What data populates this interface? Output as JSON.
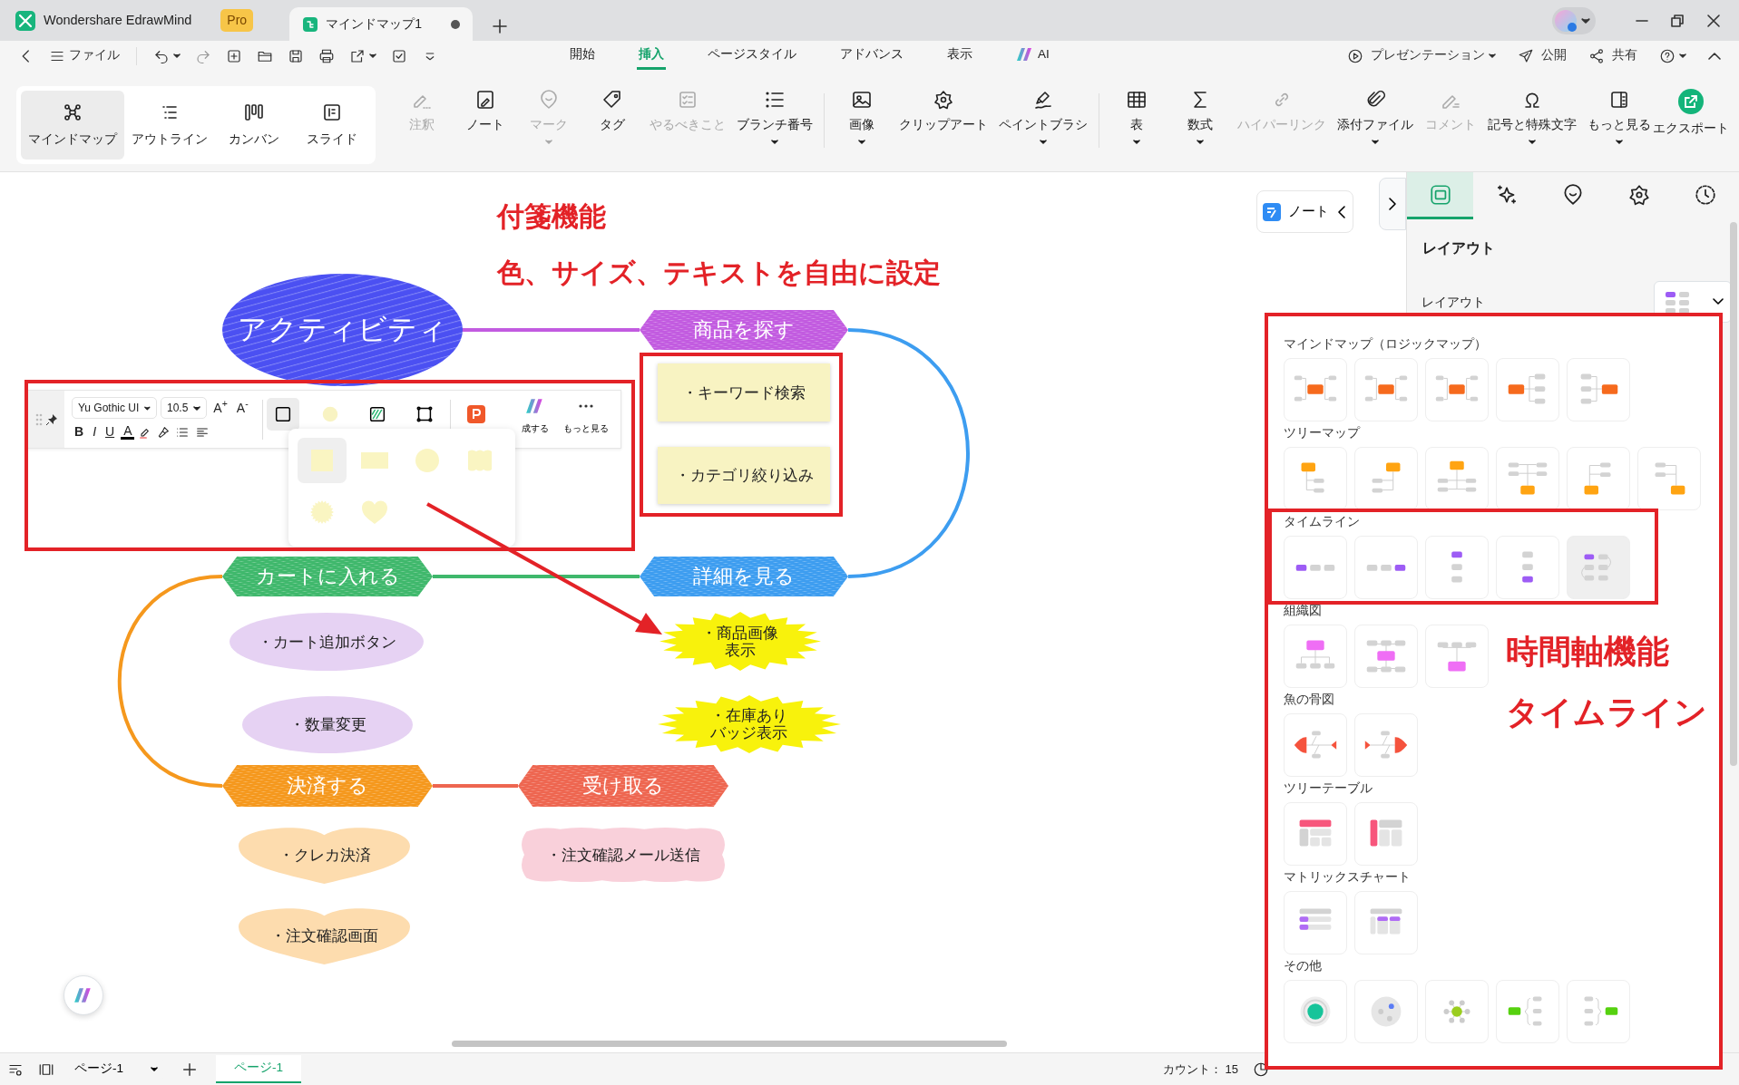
{
  "title_bar": {
    "app_name": "Wondershare EdrawMind",
    "badge": "Pro",
    "tabs": [
      {
        "label": "マインドマップ1",
        "selected": true,
        "unsaved": true
      }
    ]
  },
  "menu_bar": {
    "file_label": "ファイル",
    "tabs": [
      {
        "label": "開始",
        "selected": false
      },
      {
        "label": "挿入",
        "selected": true
      },
      {
        "label": "ページスタイル",
        "selected": false
      },
      {
        "label": "アドバンス",
        "selected": false
      },
      {
        "label": "表示",
        "selected": false
      },
      {
        "label": "AI",
        "selected": false
      }
    ],
    "actions": [
      {
        "label": "プレゼンテーション",
        "dropdown": true
      },
      {
        "label": "公開",
        "dropdown": false
      },
      {
        "label": "共有",
        "dropdown": false
      }
    ]
  },
  "ribbon": {
    "views": [
      {
        "label": "マインドマップ",
        "selected": true
      },
      {
        "label": "アウトライン",
        "selected": false
      },
      {
        "label": "カンバン",
        "selected": false
      },
      {
        "label": "スライド",
        "selected": false
      }
    ],
    "groups": [
      {
        "tools": [
          {
            "label": "注釈",
            "disabled": true,
            "dropdown": false
          },
          {
            "label": "ノート",
            "disabled": false,
            "dropdown": false
          },
          {
            "label": "マーク",
            "disabled": true,
            "dropdown": true
          },
          {
            "label": "タグ",
            "disabled": false,
            "dropdown": false
          },
          {
            "label": "やるべきこと",
            "disabled": true,
            "dropdown": false
          },
          {
            "label": "ブランチ番号",
            "disabled": false,
            "dropdown": true
          }
        ]
      },
      {
        "tools": [
          {
            "label": "画像",
            "disabled": false,
            "dropdown": true
          },
          {
            "label": "クリップアート",
            "disabled": false,
            "dropdown": false
          },
          {
            "label": "ペイントブラシ",
            "disabled": false,
            "dropdown": true
          }
        ]
      },
      {
        "tools": [
          {
            "label": "表",
            "disabled": false,
            "dropdown": true
          },
          {
            "label": "数式",
            "disabled": false,
            "dropdown": true
          },
          {
            "label": "ハイパーリンク",
            "disabled": true,
            "dropdown": false
          },
          {
            "label": "添付ファイル",
            "disabled": false,
            "dropdown": true
          },
          {
            "label": "コメント",
            "disabled": true,
            "dropdown": false
          },
          {
            "label": "記号と特殊文字",
            "disabled": false,
            "dropdown": true
          },
          {
            "label": "もっと見る",
            "disabled": false,
            "dropdown": true
          }
        ]
      }
    ],
    "export_label": "エクスポート"
  },
  "canvas": {
    "annotations": [
      {
        "text": "付箋機能"
      },
      {
        "text": "色、サイズ、テキストを自由に設定"
      }
    ],
    "nodes": [
      {
        "text": "アクティビティ",
        "kind": "central",
        "color": "#4b50f2"
      },
      {
        "text": "商品を探す",
        "kind": "main",
        "color": "#c25be0"
      },
      {
        "text": "・キーワード検索",
        "kind": "sticky",
        "color": "#f8f3c2"
      },
      {
        "text": "・カテゴリ絞り込み",
        "kind": "sticky",
        "color": "#f8f3c2"
      },
      {
        "text": "カートに入れる",
        "kind": "main",
        "color": "#3fb86c"
      },
      {
        "text": "詳細を見る",
        "kind": "main",
        "color": "#3d9df0"
      },
      {
        "text": "・カート追加ボタン",
        "kind": "ellipse",
        "color": "#e6d2f3"
      },
      {
        "text": "・商品画像表示",
        "kind": "burst",
        "color": "#f8f20c"
      },
      {
        "text": "・数量変更",
        "kind": "ellipse",
        "color": "#e6d2f3"
      },
      {
        "text": "・在庫ありバッジ表示",
        "kind": "burst",
        "color": "#f8f20c"
      },
      {
        "text": "決済する",
        "kind": "main",
        "color": "#f5981d"
      },
      {
        "text": "受け取る",
        "kind": "main",
        "color": "#ee6650"
      },
      {
        "text": "・クレカ決済",
        "kind": "heart",
        "color": "#fddcae"
      },
      {
        "text": "・注文確認メール送信",
        "kind": "cloud",
        "color": "#f9d0da"
      },
      {
        "text": "・注文確認画面",
        "kind": "heart",
        "color": "#fddcae"
      }
    ],
    "note_button": "ノート",
    "format_bar": {
      "font": "Yu Gothic UI",
      "font_size": "10.5",
      "size_keys": [
        "A$^{+}$",
        "A$^{-}$"
      ],
      "format_keys": [
        "B",
        "I",
        "U",
        "A"
      ],
      "style_tools": [
        {
          "selected": true
        },
        {
          "selected": false
        },
        {
          "selected": false
        },
        {
          "selected": false
        }
      ],
      "captions": [
        "成する",
        "もっと見る"
      ]
    },
    "shape_options": [
      {
        "selected": true
      },
      {
        "selected": false
      },
      {
        "selected": false
      },
      {
        "selected": false
      },
      {
        "selected": false
      },
      {
        "selected": false
      }
    ]
  },
  "side_panel": {
    "tabs": [
      {
        "selected": true
      },
      {
        "selected": false
      },
      {
        "selected": false
      },
      {
        "selected": false
      },
      {
        "selected": false
      }
    ],
    "heading": "レイアウト",
    "layout_label": "レイアウト"
  },
  "layout_gallery": {
    "sections": [
      {
        "title": "マインドマップ（ロジックマップ）",
        "annotated": false,
        "items": [
          {
            "selected": false
          },
          {
            "selected": false
          },
          {
            "selected": false
          },
          {
            "selected": false
          },
          {
            "selected": false
          }
        ]
      },
      {
        "title": "ツリーマップ",
        "annotated": false,
        "items": [
          {
            "selected": false
          },
          {
            "selected": false
          },
          {
            "selected": false
          },
          {
            "selected": false
          },
          {
            "selected": false
          },
          {
            "selected": false
          }
        ]
      },
      {
        "title": "タイムライン",
        "annotated": true,
        "items": [
          {
            "selected": false
          },
          {
            "selected": false
          },
          {
            "selected": false
          },
          {
            "selected": false
          },
          {
            "selected": true
          }
        ]
      },
      {
        "title": "組織図",
        "annotated": false,
        "items": [
          {
            "selected": false
          },
          {
            "selected": false
          },
          {
            "selected": false
          }
        ]
      },
      {
        "title": "魚の骨図",
        "annotated": false,
        "items": [
          {
            "selected": false
          },
          {
            "selected": false
          }
        ]
      },
      {
        "title": "ツリーテーブル",
        "annotated": false,
        "items": [
          {
            "selected": false
          },
          {
            "selected": false
          }
        ]
      },
      {
        "title": "マトリックスチャート",
        "annotated": false,
        "items": [
          {
            "selected": false
          },
          {
            "selected": false
          }
        ]
      },
      {
        "title": "その他",
        "annotated": false,
        "items": [
          {
            "selected": false
          },
          {
            "selected": false
          },
          {
            "selected": false
          },
          {
            "selected": false
          },
          {
            "selected": false
          }
        ]
      }
    ],
    "annotations": [
      {
        "text": "時間軸機能"
      },
      {
        "text": "タイムライン"
      }
    ]
  },
  "status_bar": {
    "page_select": "ページ-1",
    "page_tabs": [
      {
        "label": "ページ-1",
        "selected": true
      }
    ],
    "count": "カウント： 15"
  }
}
